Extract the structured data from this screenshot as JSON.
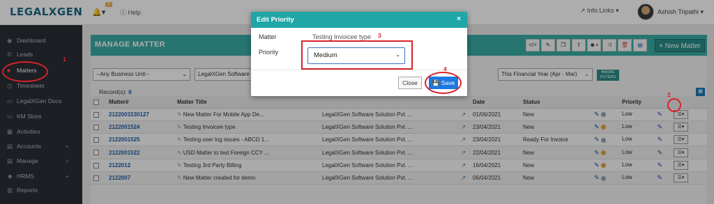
{
  "header": {
    "logo": "LEGALXGEN",
    "notifications_count": "0",
    "help_label": "Help",
    "info_links_label": "Info Links",
    "user_name": "Ashish Tripathi"
  },
  "sidebar": {
    "items": [
      {
        "label": "Dashboard",
        "icon": "dashboard-icon",
        "glyph": "◉"
      },
      {
        "label": "Leads",
        "icon": "phone-icon",
        "glyph": "✆"
      },
      {
        "label": "Matters",
        "icon": "briefcase-icon",
        "glyph": "■"
      },
      {
        "label": "Timesheet",
        "icon": "clock-icon",
        "glyph": "◷"
      },
      {
        "label": "LegalXGen Docs",
        "icon": "folder-icon",
        "glyph": "▭"
      },
      {
        "label": "KM Store",
        "icon": "folder-icon",
        "glyph": "▭"
      },
      {
        "label": "Activities",
        "icon": "calendar-icon",
        "glyph": "▦"
      },
      {
        "label": "Accounts",
        "icon": "accounts-icon",
        "glyph": "▤",
        "expandable": "+"
      },
      {
        "label": "Manage",
        "icon": "manage-icon",
        "glyph": "▤",
        "expandable": "+"
      },
      {
        "label": "HRMS",
        "icon": "users-icon",
        "glyph": "☻",
        "expandable": "+"
      },
      {
        "label": "Reports",
        "icon": "chart-icon",
        "glyph": "▥"
      }
    ]
  },
  "main": {
    "title": "MANAGE MATTER",
    "new_button_label": "+ New Matter",
    "filters": {
      "business_unit": "--Any Business Unit--",
      "company": "LegalXGen Software Solution Pvt. Ltd.",
      "period": "This Financial Year (Apr - Mar)",
      "more_filters": "MORE FILTERS"
    },
    "records_label": "Record(s):",
    "records_count": "6",
    "columns": [
      "Matter#",
      "Matter Title",
      "",
      "Date",
      "Status",
      "",
      "Priority"
    ],
    "rows": [
      {
        "matter_no": "2122001530127",
        "title": "New Matter For Mobile App De...",
        "client": "LegalXGen Software Solution Pvt. ...",
        "date": "01/06/2021",
        "status": "New",
        "dot": "#9aa5b0",
        "priority": "Low"
      },
      {
        "matter_no": "2122001524",
        "title": "Testing Invoicee type",
        "client": "LegalXGen Software Solution Pvt. ...",
        "date": "23/04/2021",
        "status": "New",
        "dot": "#e9a23b",
        "priority": "Low"
      },
      {
        "matter_no": "2122001525",
        "title": "Testing user log issues - ABCD 1...",
        "client": "LegalXGen Software Solution Pvt. ...",
        "date": "23/04/2021",
        "status": "Ready For Invoice",
        "dot": "#9aa5b0",
        "priority": "Low"
      },
      {
        "matter_no": "2122001522",
        "title": "USD Matter to test Foreign CCY ...",
        "client": "LegalXGen Software Solution Pvt. ...",
        "date": "22/04/2021",
        "status": "New",
        "dot": "#e9a23b",
        "priority": "Low"
      },
      {
        "matter_no": "2122012",
        "title": "Testing 3rd Party Billing",
        "client": "LegalXGen Software Solution Pvt. ...",
        "date": "16/04/2021",
        "status": "New",
        "dot": "#e9a23b",
        "priority": "Low"
      },
      {
        "matter_no": "2122007",
        "title": "New Matter created for demo",
        "client": "LegalXGen Software Solution Pvt. ...",
        "date": "06/04/2021",
        "status": "New",
        "dot": "#9aa5b0",
        "priority": "Low"
      }
    ]
  },
  "modal": {
    "title": "Edit Priority",
    "matter_label": "Matter",
    "matter_value": "Testing Invoicee type",
    "priority_label": "Priority",
    "priority_selected": "Medium",
    "close_label": "Close",
    "save_label": "Save"
  },
  "annotations": [
    "1",
    "2",
    "3",
    "4"
  ],
  "colors": {
    "teal_header": "#3aada6",
    "modal_header": "#1fa6a6",
    "save_blue": "#1d78e0",
    "annotation_red": "#d8222a",
    "sidebar_bg": "#2a2e35"
  }
}
